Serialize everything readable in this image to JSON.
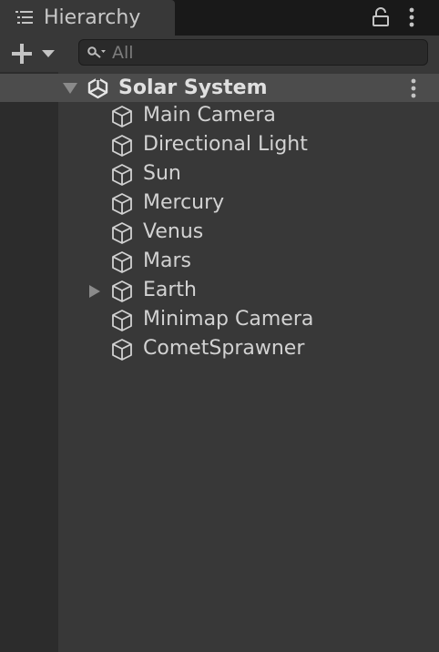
{
  "window": {
    "tab_title": "Hierarchy",
    "tab_icon": "hierarchy-list-icon",
    "lock_icon": "lock-icon",
    "menu_icon": "kebab-menu-icon"
  },
  "toolbar": {
    "create_icon": "plus-dropdown-icon",
    "search": {
      "placeholder": "All",
      "value": ""
    }
  },
  "scene": {
    "name": "Solar System",
    "icon": "unity-logo-icon",
    "expanded": true
  },
  "objects": [
    {
      "name": "Main Camera",
      "has_children": false
    },
    {
      "name": "Directional Light",
      "has_children": false
    },
    {
      "name": "Sun",
      "has_children": false
    },
    {
      "name": "Mercury",
      "has_children": false
    },
    {
      "name": "Venus",
      "has_children": false
    },
    {
      "name": "Mars",
      "has_children": false
    },
    {
      "name": "Earth",
      "has_children": true
    },
    {
      "name": "Minimap Camera",
      "has_children": false
    },
    {
      "name": "CometSprawner",
      "has_children": false
    }
  ],
  "colors": {
    "panel_bg": "#383838",
    "tab_bar_bg": "#191919",
    "selected_scene_row": "#4c4c4c",
    "text": "#d2d2d2"
  }
}
